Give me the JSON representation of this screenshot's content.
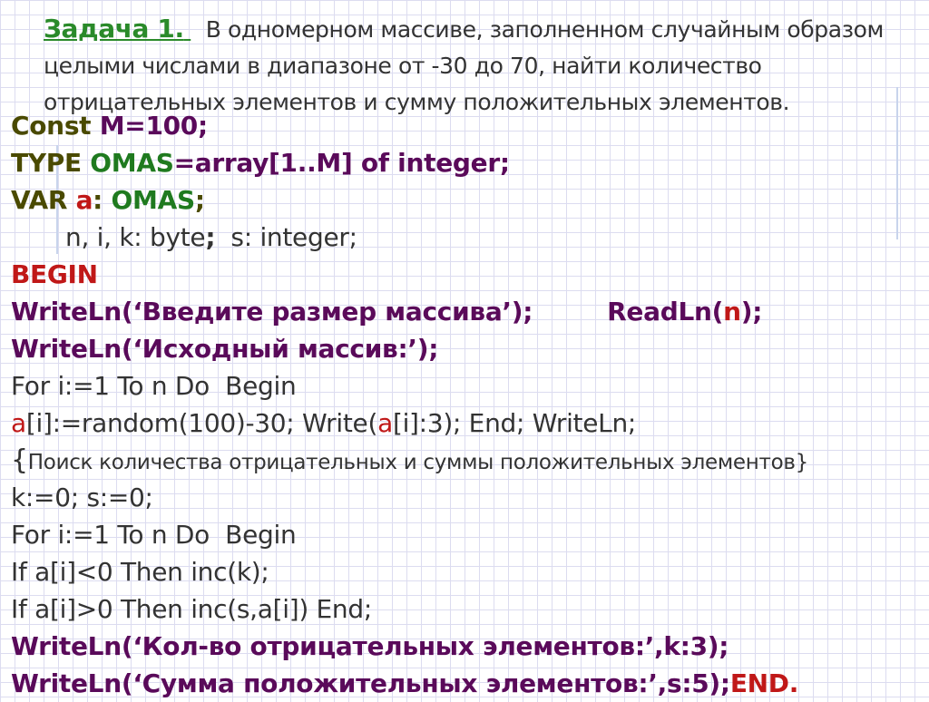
{
  "task": {
    "title": "Задача 1.",
    "text": "В одномерном массиве, заполненном случайным образом целыми числами в диапазоне от -30 до 70, найти количество отрицательных элементов и сумму положительных элементов."
  },
  "code": {
    "l1": {
      "kw": "Const ",
      "rest": "M=100;"
    },
    "l2": {
      "kw": "TYPE ",
      "name": "OMAS",
      "rest": "=array[1..M] of integer;"
    },
    "l3": {
      "kw": "VAR ",
      "var": "a",
      "colon": ": ",
      "type": "OMAS",
      "semi": ";"
    },
    "l4": {
      "a": "n, i, k: byte",
      "semi": ";",
      "b": "  s: integer;"
    },
    "l5": {
      "kw": "BEGIN"
    },
    "l6": {
      "a": "WriteLn(‘Введите размер массива’);",
      "b": "ReadLn(",
      "var": "n",
      "c": ");"
    },
    "l7": {
      "text": "WriteLn(‘Исходный массив:’);"
    },
    "l8": {
      "text": "For i:=1 To n Do  Begin"
    },
    "l9": {
      "v1": "a",
      "t1": "[i]:=random(100)-30; Write(",
      "v2": "a",
      "t2": "[i]:3); End; WriteLn;"
    },
    "l10": {
      "open": "{",
      "text": "Поиск количества отрицательных и суммы положительных элементов",
      "close": "}"
    },
    "l11": {
      "text": "k:=0; s:=0;"
    },
    "l12": {
      "text": "For i:=1 To n Do  Begin"
    },
    "l13": {
      "text": "If a[i]<0 Then inc(k);"
    },
    "l14": {
      "text": "If a[i]>0 Then inc(s,a[i]) End;"
    },
    "l15": {
      "text": "WriteLn(‘Кол-во отрицательных элементов:’,k:3);"
    },
    "l16": {
      "text": "WriteLn(‘Сумма положительных элементов:’,s:5);",
      "end": "END."
    }
  }
}
